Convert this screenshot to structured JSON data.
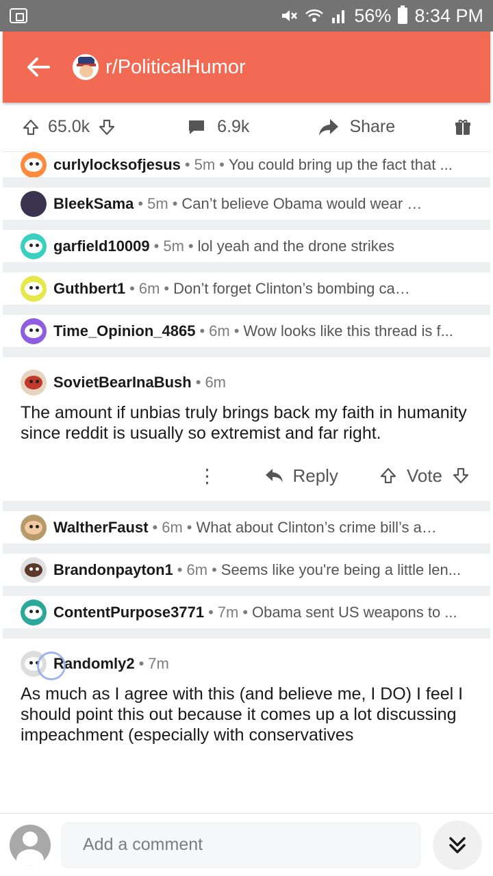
{
  "status_bar": {
    "battery": "56%",
    "time": "8:34 PM"
  },
  "header": {
    "subreddit": "r/PoliticalHumor"
  },
  "post_actions": {
    "upvotes": "65.0k",
    "comments": "6.9k",
    "share_label": "Share"
  },
  "comments": [
    {
      "user": "curlylocksofjesus",
      "age": "5m",
      "snippet": "You could bring up the fact that ...",
      "avatar_color": "#ff8a3d"
    },
    {
      "user": "BleekSama",
      "age": "5m",
      "snippet": "Can’t believe Obama would wear a tan ...",
      "avatar_color": "#3a3450"
    },
    {
      "user": "garfield10009",
      "age": "5m",
      "snippet": "lol yeah and the drone strikes",
      "avatar_color": "#3ad0c0"
    },
    {
      "user": "Guthbert1",
      "age": "6m",
      "snippet": "Don’t forget Clinton’s  bombing campaig...",
      "avatar_color": "#e6e84a"
    },
    {
      "user": "Time_Opinion_4865",
      "age": "6m",
      "snippet": "Wow looks like this thread is f...",
      "avatar_color": "#8f5ee0"
    }
  ],
  "expanded_comment": {
    "user": "SovietBearInaBush",
    "age": "6m",
    "body": "The amount if unbias truly brings back my faith in humanity since reddit is usually so extremist and far right.",
    "reply_label": "Reply",
    "vote_label": "Vote",
    "avatar_color": "#e8d3c0"
  },
  "comments2": [
    {
      "user": "WaltherFaust",
      "age": "6m",
      "snippet": "What about Clinton’s crime bill’s and ...",
      "avatar_color": "#b89a6a"
    },
    {
      "user": "Brandonpayton1",
      "age": "6m",
      "snippet": "Seems like you're being a little len...",
      "avatar_color": "#e0e0e0"
    },
    {
      "user": "ContentPurpose3771",
      "age": "7m",
      "snippet": "Obama sent US weapons to ...",
      "avatar_color": "#2aa89a"
    }
  ],
  "expanded_comment2": {
    "user": "Randomly2",
    "age": "7m",
    "body": "As much as I agree with this (and believe me, I DO) I feel I should point this out because it comes up a lot discussing impeachment (especially with conservatives",
    "avatar_color": "#ddd"
  },
  "composer": {
    "placeholder": "Add a comment"
  },
  "colors": {
    "app_bar": "#f26a54",
    "status_bar": "#737373"
  },
  "icons": [
    "back-arrow-icon",
    "upvote-icon",
    "downvote-icon",
    "comment-icon",
    "share-icon",
    "gift-icon",
    "more-icon",
    "reply-icon",
    "jump-down-icon"
  ]
}
